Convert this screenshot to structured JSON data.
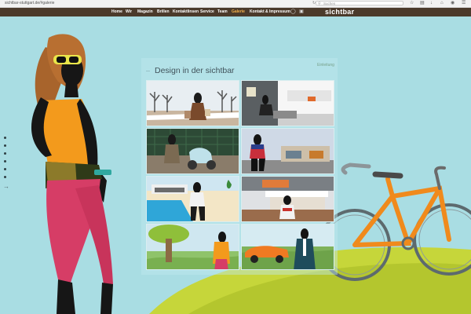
{
  "browser": {
    "url": "sichtbar-stuttgart.de/#galerie",
    "search_placeholder": "Suchen",
    "toolbar_icons": [
      "star-icon",
      "clipboard-icon",
      "download-icon",
      "home-icon",
      "chat-icon",
      "menu-icon"
    ]
  },
  "site": {
    "logo": "sichtbar",
    "nav": [
      "Home",
      "Wir",
      "Magazin",
      "Brillen",
      "Kontaktlinsen",
      "Service",
      "Team",
      "Galerie",
      "Kontakt & Impressum"
    ],
    "active_nav": "Galerie",
    "social_icons": [
      "facebook-icon",
      "instagram-icon"
    ]
  },
  "gallery": {
    "title": "Design in der sichtbar",
    "link": "Einleitung",
    "tiles": [
      "winter-shopping-scene",
      "modern-living-room-scene",
      "man-with-scooter-scene",
      "man-in-front-of-modern-house-scene",
      "poolside-scene",
      "cafe-terrace-scene",
      "park-tree-scene",
      "man-with-orange-sportscar-scene"
    ]
  },
  "colors": {
    "background": "#a9dde3",
    "nav_bar": "#4b3a2b",
    "active_nav": "#f4b04a"
  }
}
